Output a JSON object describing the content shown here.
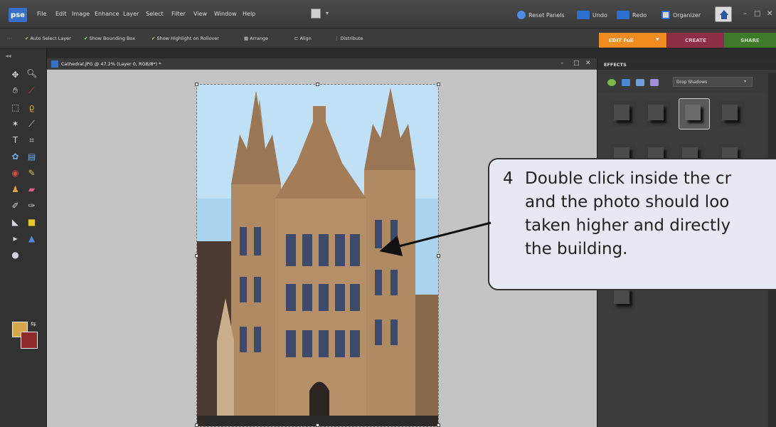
{
  "app": {
    "logo": "pse"
  },
  "menu": [
    "File",
    "Edit",
    "Image",
    "Enhance",
    "Layer",
    "Select",
    "Filter",
    "View",
    "Window",
    "Help"
  ],
  "toolbar": {
    "reset_panels": "Reset Panels",
    "undo": "Undo",
    "redo": "Redo",
    "organizer": "Organizer"
  },
  "options": {
    "auto_select": "Auto Select Layer",
    "bounding_box": "Show Bounding Box",
    "highlight": "Show Highlight on Rollover",
    "arrange": "Arrange",
    "align": "Align",
    "distribute": "Distribute"
  },
  "mode_tabs": {
    "edit": "EDIT Full",
    "create": "CREATE",
    "share": "SHARE"
  },
  "document": {
    "title": "Cathedral.JPG @ 47.2% (Layer 0, RGB/8*) *"
  },
  "effects_panel": {
    "label": "EFFECTS",
    "category": "Drop Shadows"
  },
  "callout": {
    "number": "4",
    "lines": [
      "Double click inside the cr",
      "and the photo should loo",
      "taken higher and directly",
      "the building."
    ]
  },
  "colors": {
    "accent_edit": "#f08c1f",
    "accent_create": "#8e2f47",
    "accent_share": "#3e7a2a",
    "foreground": "#d6a64e",
    "background": "#8e2a2a"
  }
}
